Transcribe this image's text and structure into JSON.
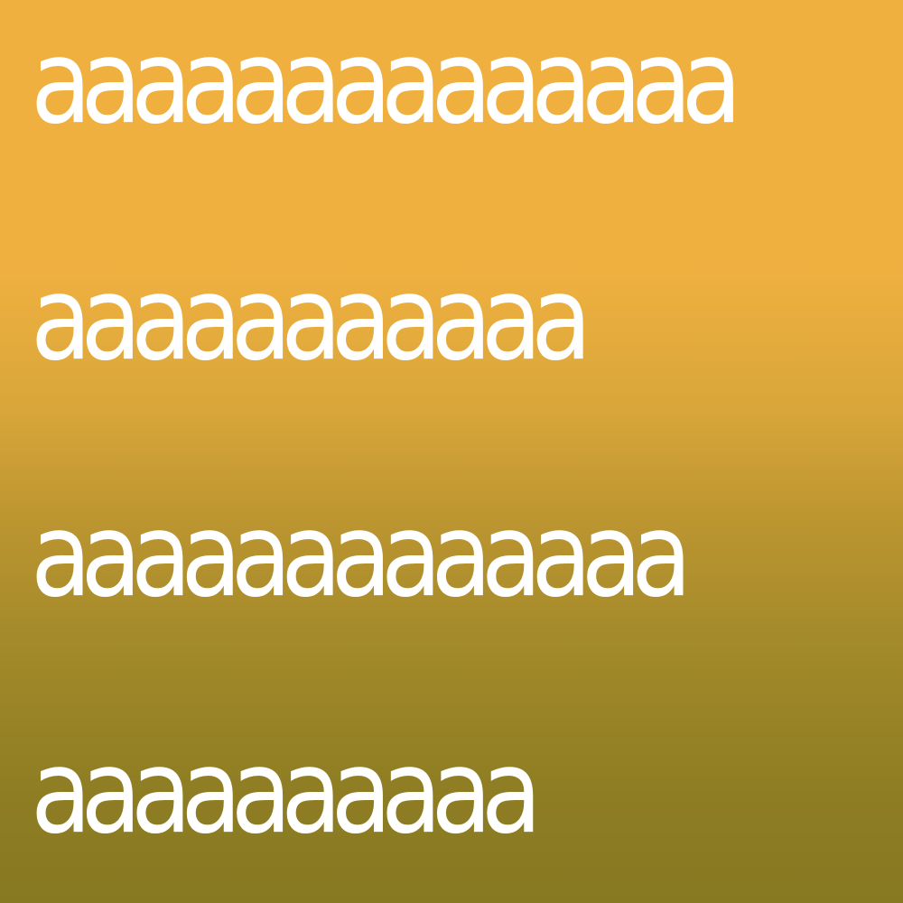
{
  "lines": [
    "aaaaaaaaaaaaaa",
    "aaaaaaaaaaa",
    "aaaaaaaaaaaaa",
    "aaaaaaaaaa"
  ],
  "colors": {
    "text": "#ffffff",
    "background_top": "#efb040",
    "background_bottom": "#877922"
  }
}
